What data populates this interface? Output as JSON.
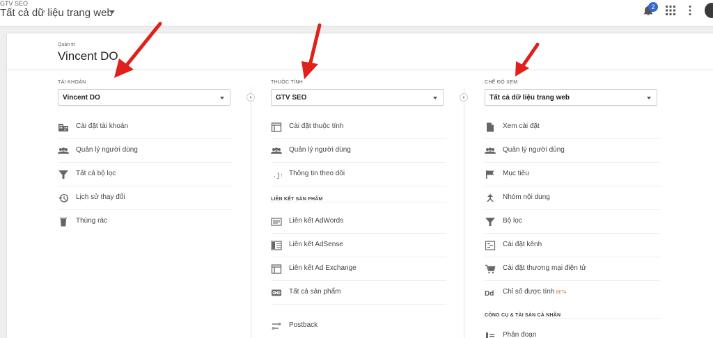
{
  "header": {
    "account_small": "GTV SEO",
    "view_title": "Tất cả dữ liệu trang web",
    "notification_count": "2"
  },
  "admin": {
    "label": "Quản trị",
    "name": "Vincent DO"
  },
  "account_col": {
    "heading": "TÀI KHOẢN",
    "selected": "Vincent DO",
    "items": [
      {
        "label": "Cài đặt tài khoản",
        "icon": "building-icon"
      },
      {
        "label": "Quản lý người dùng",
        "icon": "users-icon"
      },
      {
        "label": "Tất cả bộ lọc",
        "icon": "filter-icon"
      },
      {
        "label": "Lịch sử thay đổi",
        "icon": "history-icon"
      },
      {
        "label": "Thùng rác",
        "icon": "trash-icon"
      }
    ]
  },
  "property_col": {
    "heading": "THUỘC TÍNH",
    "selected": "GTV SEO",
    "items": [
      {
        "label": "Cài đặt thuộc tính",
        "icon": "window-icon"
      },
      {
        "label": "Quản lý người dùng",
        "icon": "users-icon"
      },
      {
        "label": "Thông tin theo dõi",
        "icon": "js-icon"
      }
    ],
    "section": "LIÊN KẾT SẢN PHẨM",
    "product_items": [
      {
        "label": "Liên kết AdWords",
        "icon": "adwords-icon"
      },
      {
        "label": "Liên kết AdSense",
        "icon": "adsense-icon"
      },
      {
        "label": "Liên kết Ad Exchange",
        "icon": "ad-exchange-icon"
      },
      {
        "label": "Tất cả sản phẩm",
        "icon": "link-icon"
      },
      {
        "label": "Postback",
        "icon": "postback-icon"
      }
    ]
  },
  "view_col": {
    "heading": "CHẾ ĐỘ XEM",
    "selected": "Tất cả dữ liệu trang web",
    "items": [
      {
        "label": "Xem cài đặt",
        "icon": "document-icon"
      },
      {
        "label": "Quản lý người dùng",
        "icon": "users-icon"
      },
      {
        "label": "Mục tiêu",
        "icon": "flag-icon"
      },
      {
        "label": "Nhóm nội dung",
        "icon": "content-group-icon"
      },
      {
        "label": "Bộ lọc",
        "icon": "filter-icon"
      },
      {
        "label": "Cài đặt kênh",
        "icon": "channel-icon"
      },
      {
        "label": "Cài đặt thương mại điện tử",
        "icon": "cart-icon"
      },
      {
        "label": "Chỉ số được tính",
        "icon": "dd-icon"
      }
    ],
    "beta": "BETA",
    "section": "CÔNG CỤ & TÀI SẢN CÁ NHÂN",
    "tools_items": [
      {
        "label": "Phân đoạn",
        "icon": "segments-icon"
      }
    ]
  },
  "colors": {
    "arrow": "#e0201b",
    "badge": "#3367d6",
    "beta": "#e15a22"
  }
}
